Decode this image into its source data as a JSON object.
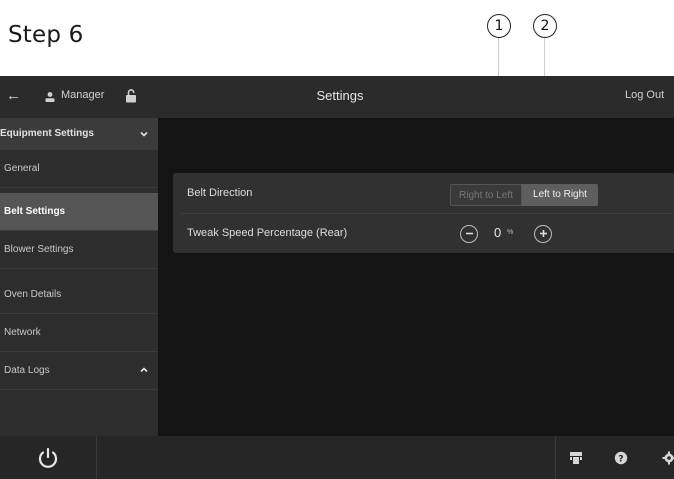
{
  "page": {
    "step_title": "Step 6",
    "callouts": [
      "1",
      "2"
    ]
  },
  "topbar": {
    "back_icon": "arrow-left-icon",
    "user_icon": "user-icon",
    "user_name": "Manager",
    "lock_icon": "unlock-icon",
    "title": "Settings",
    "logout_label": "Log Out"
  },
  "sidebar": {
    "section_label": "Equipment Settings",
    "section_expanded": true,
    "items": [
      {
        "label": "General",
        "active": false
      },
      {
        "label": "Belt Settings",
        "active": true
      },
      {
        "label": "Blower Settings",
        "active": false
      },
      {
        "label": "Oven Details",
        "active": false
      },
      {
        "label": "Network",
        "active": false
      },
      {
        "label": "Data Logs",
        "active": false
      }
    ]
  },
  "settings": {
    "belt_direction": {
      "label": "Belt Direction",
      "options": [
        "Right to Left",
        "Left to Right"
      ],
      "selected": "Left to Right"
    },
    "tweak_speed": {
      "label": "Tweak Speed Percentage (Rear)",
      "value": "0",
      "unit": "%",
      "decrement_icon": "minus-icon",
      "increment_icon": "plus-icon"
    }
  },
  "bottombar": {
    "icons": [
      "power-icon",
      "scan-icon",
      "help-icon",
      "gear-icon"
    ]
  },
  "colors": {
    "screen_bg": "#141414",
    "topbar_bg": "#2b2b2b",
    "sidebar_bg": "#2d2d2d",
    "active_item_bg": "#555555",
    "panel_bg": "#313131"
  }
}
